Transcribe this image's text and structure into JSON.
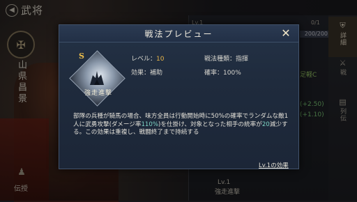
{
  "screen": {
    "back_title": "武将",
    "commander_name": "山県昌景",
    "bottom_left_label": "伝授",
    "right_panel": {
      "level_label": "Lv.1",
      "count": "0/1",
      "bar_text": "200/200",
      "stats": [
        {
          "label": "足軽C",
          "color": "#9fd06a"
        },
        {
          "label": "(+2.50)",
          "color": "#7fcf7a"
        },
        {
          "label": "(+1.10)",
          "color": "#7fcf7a"
        }
      ],
      "bottom_level": "Lv.1",
      "bottom_skill": "強走進撃"
    },
    "side_tabs": [
      {
        "label": "詳細",
        "icon": "helmet-icon",
        "active": true
      },
      {
        "label": "戦",
        "icon": "sword-icon",
        "active": false
      },
      {
        "label": "列伝",
        "icon": "book-icon",
        "active": false
      }
    ]
  },
  "modal": {
    "title": "戦法プレビュー",
    "grade": "S",
    "skill_name": "強走進撃",
    "level_label": "レベル：",
    "level_value": "10",
    "effect_label": "効果：",
    "effect_value": "補助",
    "type_label": "戦法種類：",
    "type_value": "指揮",
    "rate_label": "確率：",
    "rate_value": "100%",
    "description_parts": [
      {
        "text": "部隊の兵種が騎馬の場合、味方全員は行動開始時に50%の確率でランダムな敵1人に武勇攻撃(ダメージ率",
        "hl": false
      },
      {
        "text": "110%",
        "hl": true
      },
      {
        "text": ")を仕掛け、対象となった相手の統率が",
        "hl": false
      },
      {
        "text": "20",
        "hl": true
      },
      {
        "text": "減少する。この効果は重複し、戦闘終了まで持続する",
        "hl": false
      }
    ],
    "level_effect_link": "Lv.1の効果"
  }
}
